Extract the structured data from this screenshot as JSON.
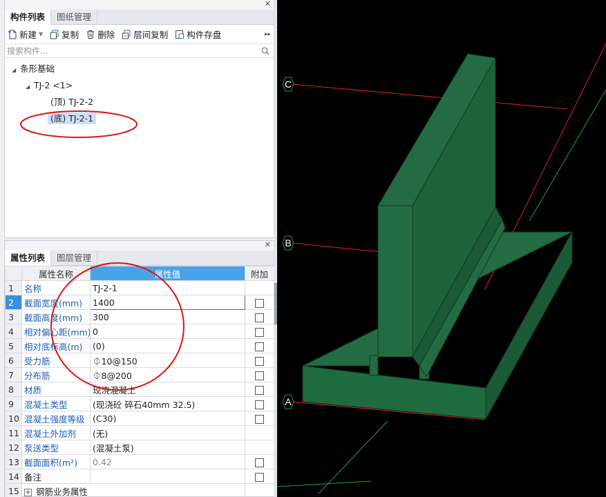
{
  "component_panel": {
    "tabs": [
      "构件列表",
      "图纸管理"
    ],
    "toolbar": {
      "new_label": "新建",
      "copy_label": "复制",
      "delete_label": "删除",
      "floor_copy_label": "层间复制",
      "save_label": "构件存盘"
    },
    "search_placeholder": "搜索构件...",
    "tree": {
      "root": "条形基础",
      "child": "TJ-2 <1>",
      "top_item": "(顶) TJ-2-2",
      "bottom_item": "(底) TJ-2-1"
    }
  },
  "property_panel": {
    "tabs": [
      "属性列表",
      "图层管理"
    ],
    "headers": {
      "name": "属性名称",
      "value": "属性值",
      "extra": "附加"
    },
    "rows": [
      {
        "num": "1",
        "name": "名称",
        "value": "TJ-2-1"
      },
      {
        "num": "2",
        "name": "截面宽度(mm)",
        "value": "1400"
      },
      {
        "num": "3",
        "name": "截面高度(mm)",
        "value": "300"
      },
      {
        "num": "4",
        "name": "相对偏心距(mm)",
        "value": "0"
      },
      {
        "num": "5",
        "name": "相对底标高(m)",
        "value": "(0)"
      },
      {
        "num": "6",
        "name": "受力筋",
        "value": "⏀10@150"
      },
      {
        "num": "7",
        "name": "分布筋",
        "value": "⏀8@200"
      },
      {
        "num": "8",
        "name": "材质",
        "value": "现浇混凝土"
      },
      {
        "num": "9",
        "name": "混凝土类型",
        "value": "(现浇砼 碎石40mm 32.5)"
      },
      {
        "num": "10",
        "name": "混凝土强度等级",
        "value": "(C30)"
      },
      {
        "num": "11",
        "name": "混凝土外加剂",
        "value": "(无)"
      },
      {
        "num": "12",
        "name": "泵送类型",
        "value": "(混凝土泵)"
      },
      {
        "num": "13",
        "name": "截面面积(m²)",
        "value": "0.42"
      },
      {
        "num": "14",
        "name": "备注",
        "value": ""
      },
      {
        "num": "15",
        "name": "钢筋业务属性",
        "value": ""
      }
    ]
  },
  "viewport": {
    "axis_labels": [
      "C",
      "B",
      "A"
    ],
    "colors": {
      "background": "#000000",
      "concrete": "#1f6b40",
      "axis_line": "#e0202a",
      "grid_line": "#1aa53a",
      "annotation": "#e01010"
    }
  }
}
